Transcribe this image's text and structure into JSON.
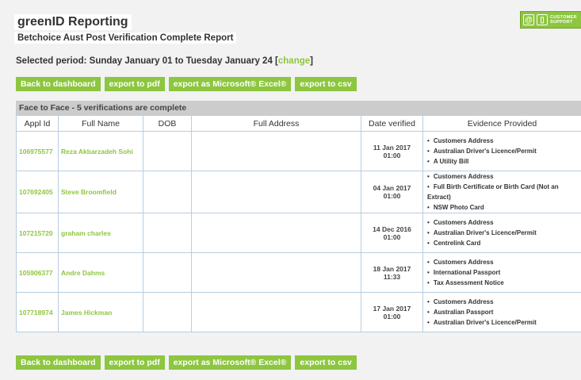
{
  "header": {
    "brand": "greenID Reporting",
    "report_title": "Betchoice Aust Post Verification Complete Report",
    "support_line1": "CUSTOMER",
    "support_line2": "SUPPORT"
  },
  "period": {
    "label": "Selected period:",
    "range": "Sunday January 01 to Tuesday January 24",
    "change_label": "change"
  },
  "buttons": {
    "dashboard": "Back to dashboard",
    "pdf": "export to pdf",
    "excel": "export as Microsoft® Excel®",
    "csv": "export to csv"
  },
  "table": {
    "caption": "Face to Face - 5 verifications are complete",
    "columns": [
      "Appl Id",
      "Full Name",
      "DOB",
      "Full Address",
      "Date verified",
      "Evidence Provided"
    ],
    "rows": [
      {
        "appl_id": "106975577",
        "full_name": "Reza Akbarzadeh Sohi",
        "dob": "",
        "address": "",
        "date": "11 Jan 2017 01:00",
        "evidence": [
          "Customers Address",
          "Australian Driver's Licence/Permit",
          "A Utility Bill"
        ]
      },
      {
        "appl_id": "107692405",
        "full_name": "Steve Broomfield",
        "dob": "",
        "address": "",
        "date": "04 Jan 2017 01:00",
        "evidence": [
          "Customers Address",
          "Full Birth Certificate or Birth Card (Not an Extract)",
          "NSW Photo Card"
        ]
      },
      {
        "appl_id": "107215720",
        "full_name": "graham charles",
        "dob": "",
        "address": "",
        "date": "14 Dec 2016 01:00",
        "evidence": [
          "Customers Address",
          "Australian Driver's Licence/Permit",
          "Centrelink Card"
        ]
      },
      {
        "appl_id": "105906377",
        "full_name": "Andre Dahms",
        "dob": "",
        "address": "",
        "date": "18 Jan 2017 11:33",
        "evidence": [
          "Customers Address",
          "International Passport",
          "Tax Assessment Notice"
        ]
      },
      {
        "appl_id": "107718974",
        "full_name": "James Hickman",
        "dob": "",
        "address": "",
        "date": "17 Jan 2017 01:00",
        "evidence": [
          "Customers Address",
          "Australian Passport",
          "Australian Driver's Licence/Permit"
        ]
      }
    ]
  },
  "colors": {
    "accent": "#8dc63f",
    "caption_bg": "#cccccc",
    "border": "#b8cde0"
  }
}
